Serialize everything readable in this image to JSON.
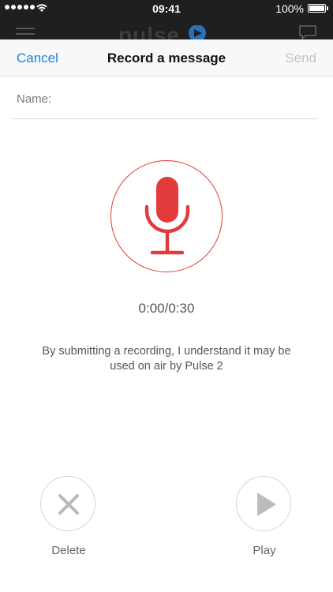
{
  "status_bar": {
    "time": "09:41",
    "battery": "100%",
    "signal_icon": "signal-dots-icon",
    "wifi_icon": "wifi-icon",
    "battery_icon": "battery-icon"
  },
  "background_app": {
    "logo": "pulse2",
    "menu_icon": "hamburger-menu-icon",
    "chat_icon": "chat-bubble-icon"
  },
  "nav": {
    "cancel_label": "Cancel",
    "title": "Record a message",
    "send_label": "Send"
  },
  "form": {
    "name_label": "Name:",
    "name_value": "",
    "name_placeholder": ""
  },
  "recorder": {
    "mic_icon": "microphone-icon",
    "elapsed": "0:00",
    "total": "0:30",
    "timer_text": "0:00/0:30",
    "accent_color": "#e33a3c"
  },
  "disclaimer": "By submitting a recording, I understand it may be used on air by Pulse 2",
  "actions": {
    "delete_label": "Delete",
    "delete_icon": "close-x-icon",
    "play_label": "Play",
    "play_icon": "play-icon"
  },
  "colors": {
    "link_blue": "#1a82e0",
    "disabled_gray": "#c4c4c4",
    "accent_red": "#e33a3c"
  }
}
